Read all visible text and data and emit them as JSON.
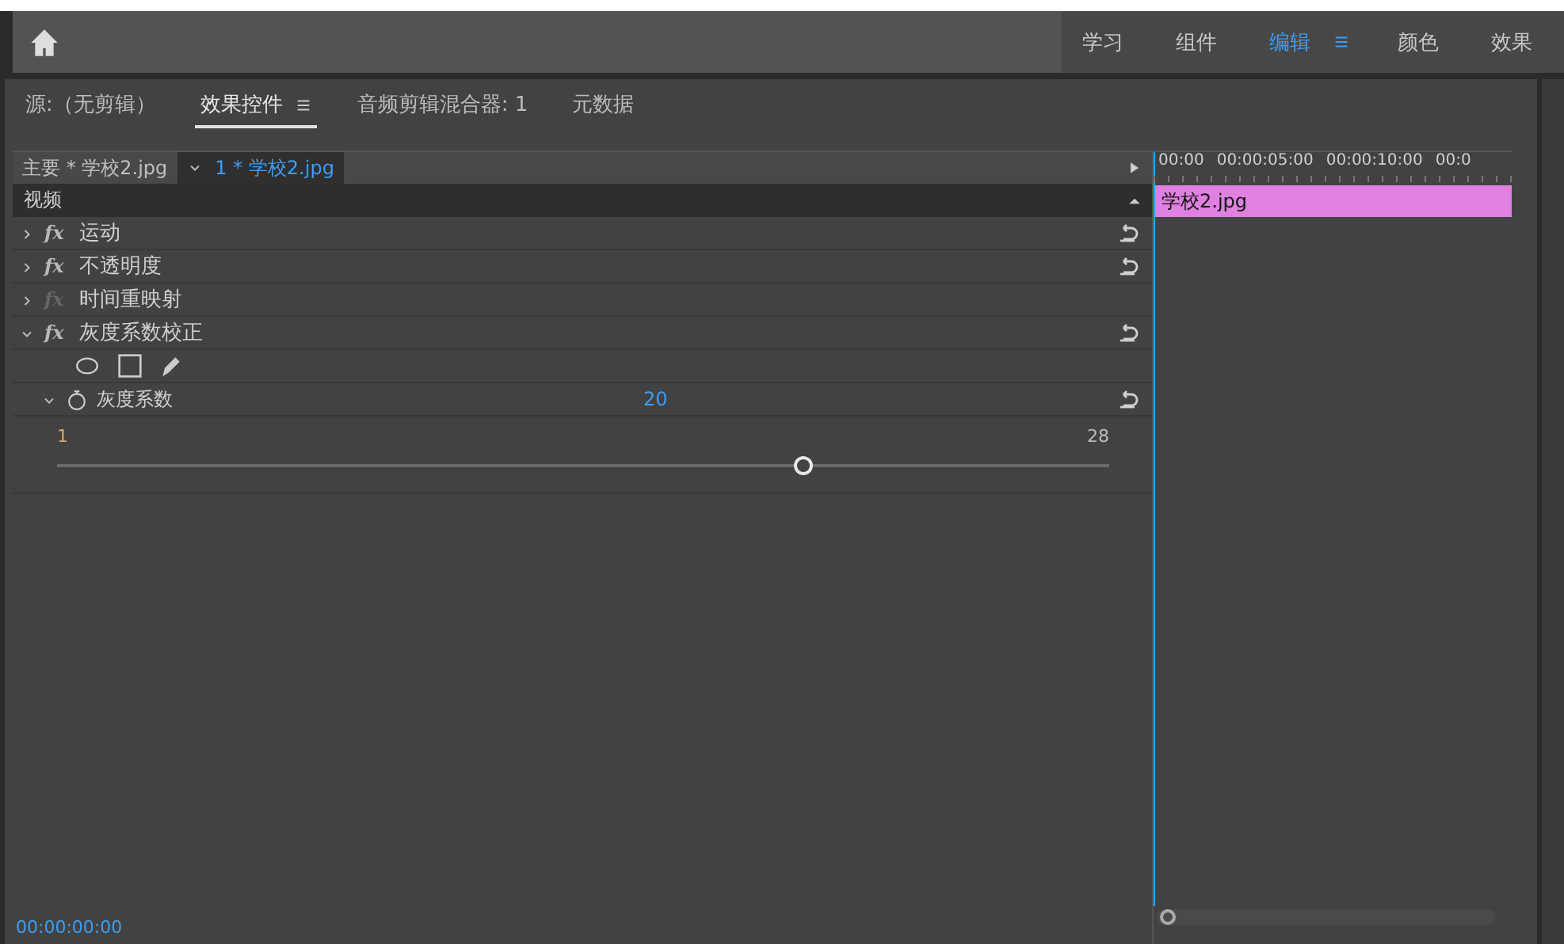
{
  "workspaces": [
    {
      "label": "学习",
      "selected": false
    },
    {
      "label": "组件",
      "selected": false
    },
    {
      "label": "编辑",
      "selected": true
    },
    {
      "label": "颜色",
      "selected": false
    },
    {
      "label": "效果",
      "selected": false
    }
  ],
  "panel_tabs": [
    {
      "label": "源:（无剪辑）",
      "selected": false
    },
    {
      "label": "效果控件",
      "selected": true
    },
    {
      "label": "音频剪辑混合器: 1",
      "selected": false
    },
    {
      "label": "元数据",
      "selected": false
    }
  ],
  "clip_tabs": [
    {
      "label": "主要 * 学校2.jpg",
      "selected": false
    },
    {
      "label": "1 * 学校2.jpg",
      "selected": true
    }
  ],
  "section": "视频",
  "effects": [
    {
      "name": "运动",
      "fx_label": "fx",
      "expanded": false,
      "fx_active": true,
      "resettable": true
    },
    {
      "name": "不透明度",
      "fx_label": "fx",
      "expanded": false,
      "fx_active": true,
      "resettable": true
    },
    {
      "name": "时间重映射",
      "fx_label": "fx",
      "expanded": false,
      "fx_active": false,
      "resettable": false
    },
    {
      "name": "灰度系数校正",
      "fx_label": "fx",
      "expanded": true,
      "fx_active": true,
      "resettable": true,
      "mask_tools": true,
      "params": [
        {
          "name": "灰度系数",
          "value": "20",
          "expanded": true,
          "min": "1",
          "max": "28",
          "level": 0.709
        }
      ]
    }
  ],
  "timeline": {
    "ticks": [
      "00:00",
      "00:00:05:00",
      "00:00:10:00",
      "00:0"
    ],
    "clip": {
      "label": "学校2.jpg",
      "color": "#e080e0"
    }
  },
  "timecode": "00:00:00:00"
}
